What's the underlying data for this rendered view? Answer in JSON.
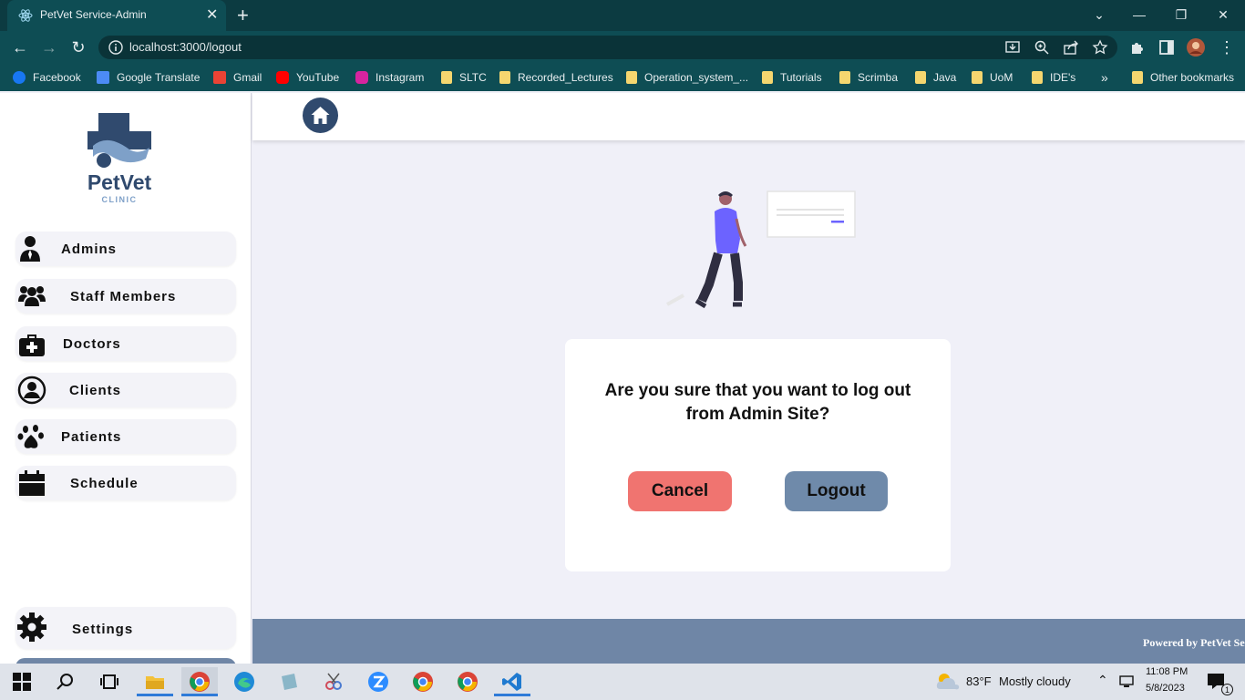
{
  "browser": {
    "tab_title": "PetVet Service-Admin",
    "url": "localhost:3000/logout",
    "bookmarks": [
      {
        "label": "Facebook"
      },
      {
        "label": "Google Translate"
      },
      {
        "label": "Gmail"
      },
      {
        "label": "YouTube"
      },
      {
        "label": "Instagram"
      },
      {
        "label": "SLTC"
      },
      {
        "label": "Recorded_Lectures"
      },
      {
        "label": "Operation_system_..."
      },
      {
        "label": "Tutorials"
      },
      {
        "label": "Scrimba"
      },
      {
        "label": "Java"
      },
      {
        "label": "UoM"
      },
      {
        "label": "IDE's"
      }
    ],
    "more_bookmarks": "»",
    "other_bookmarks": "Other bookmarks"
  },
  "sidebar": {
    "items": [
      {
        "label": "Admins"
      },
      {
        "label": "Staff Members"
      },
      {
        "label": "Doctors"
      },
      {
        "label": "Clients"
      },
      {
        "label": "Patients"
      },
      {
        "label": "Schedule"
      }
    ],
    "settings_label": "Settings"
  },
  "logo": {
    "name": "PetVet",
    "sub": "CLINIC"
  },
  "dialog": {
    "message": "Are you sure that you want to log out from Admin Site?",
    "cancel_label": "Cancel",
    "logout_label": "Logout"
  },
  "footer": {
    "text": "Powered by PetVet Se"
  },
  "taskbar": {
    "weather_temp": "83°F",
    "weather_desc": "Mostly cloudy",
    "time": "11:08 PM",
    "date": "5/8/2023",
    "notification_count": "1"
  },
  "colors": {
    "chrome_dark": "#0c3b41",
    "chrome": "#0e4d54",
    "cancel": "#f07470",
    "logout": "#6f8aaa",
    "footer": "#6f86a6",
    "home": "#304a6e"
  }
}
